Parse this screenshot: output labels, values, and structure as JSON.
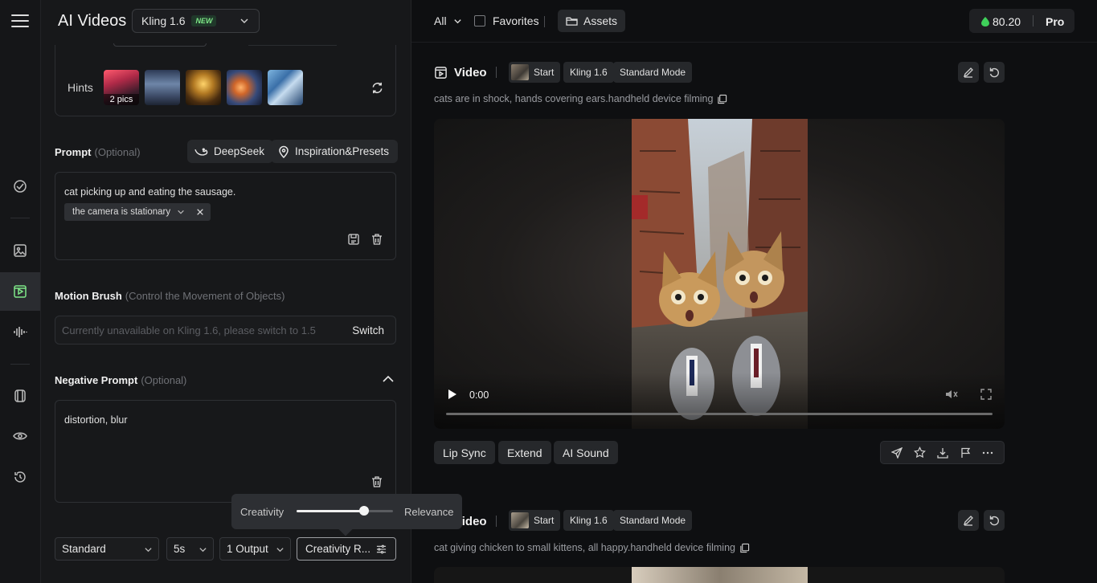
{
  "header": {
    "title": "AI Videos",
    "model": "Kling 1.6",
    "model_badge": "NEW"
  },
  "hints": {
    "label": "Hints",
    "first_count": "2 pics"
  },
  "prompt": {
    "label": "Prompt",
    "optional": "(Optional)",
    "deepseek_label": "DeepSeek",
    "inspiration_label": "Inspiration&Presets",
    "text": "cat picking up and eating the sausage.",
    "tag": "the camera is stationary"
  },
  "motion_brush": {
    "label": "Motion Brush",
    "hint": "(Control the Movement of Objects)",
    "placeholder": "Currently unavailable on Kling 1.6, please switch to 1.5",
    "switch_label": "Switch"
  },
  "negative_prompt": {
    "label": "Negative Prompt",
    "optional": "(Optional)",
    "text": "distortion, blur"
  },
  "settings": {
    "mode": "Standard",
    "duration": "5s",
    "outputs": "1 Output",
    "creativity": "Creativity R...",
    "slider_left": "Creativity",
    "slider_right": "Relevance",
    "slider_value": 0.7
  },
  "filters": {
    "all": "All",
    "favorites": "Favorites",
    "assets": "Assets"
  },
  "account": {
    "credits": "80.20",
    "plan": "Pro"
  },
  "cards": [
    {
      "title": "Video",
      "start": "Start",
      "model": "Kling 1.6",
      "mode": "Standard Mode",
      "caption": "cats are in shock, hands covering ears.handheld device filming",
      "time": "0:00",
      "actions": [
        "Lip Sync",
        "Extend",
        "AI Sound"
      ]
    },
    {
      "title": "Video",
      "start": "Start",
      "model": "Kling 1.6",
      "mode": "Standard Mode",
      "caption": "cat giving chicken to small kittens, all happy.handheld device filming"
    }
  ],
  "colors": {
    "accent_green": "#7ee787",
    "panel_bg": "#17181a",
    "main_bg": "#0e0f11"
  }
}
